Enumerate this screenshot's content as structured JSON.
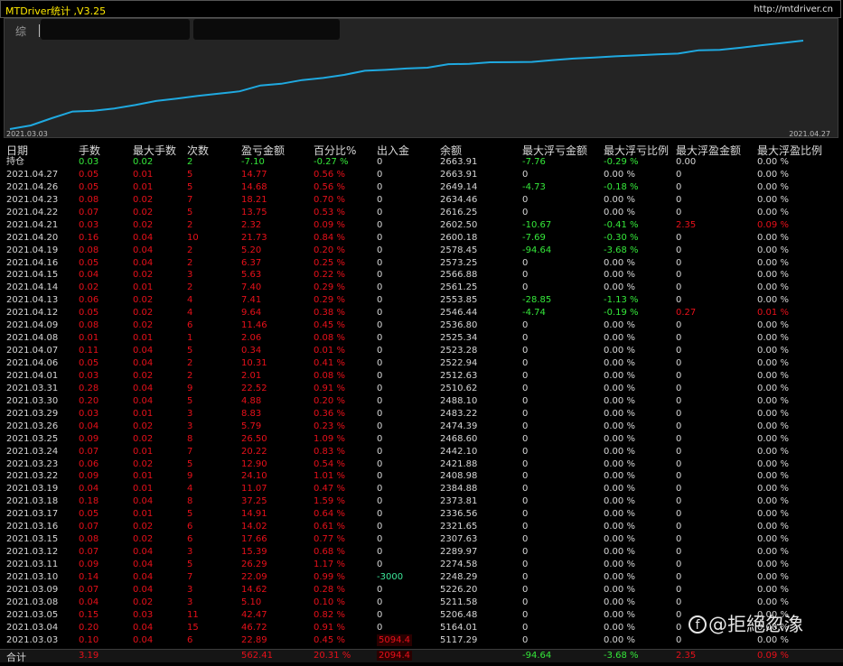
{
  "app": {
    "title": "MTDriver统计 ,V3.25",
    "url": "http://mtdriver.cn"
  },
  "chart_panel": {
    "tab_label": "综",
    "start_date": "2021.03.03",
    "end_date": "2021.04.27",
    "line_color": "#1fa9e0"
  },
  "chart_data": {
    "type": "line",
    "title": "",
    "xlabel": "",
    "ylabel": "",
    "x": [
      "2021.03.03",
      "2021.03.04",
      "2021.03.05",
      "2021.03.08",
      "2021.03.09",
      "2021.03.10",
      "2021.03.11",
      "2021.03.12",
      "2021.03.15",
      "2021.03.16",
      "2021.03.17",
      "2021.03.18",
      "2021.03.19",
      "2021.03.22",
      "2021.03.23",
      "2021.03.24",
      "2021.03.25",
      "2021.03.26",
      "2021.03.29",
      "2021.03.30",
      "2021.03.31",
      "2021.04.01",
      "2021.04.06",
      "2021.04.07",
      "2021.04.08",
      "2021.04.09",
      "2021.04.12",
      "2021.04.13",
      "2021.04.14",
      "2021.04.15",
      "2021.04.16",
      "2021.04.19",
      "2021.04.20",
      "2021.04.21",
      "2021.04.22",
      "2021.04.23",
      "2021.04.26",
      "2021.04.27"
    ],
    "series": [
      {
        "values": [
          22.89,
          69.62,
          112.09,
          117.19,
          131.81,
          153.9,
          180.19,
          195.58,
          213.24,
          227.26,
          242.17,
          279.42,
          290.49,
          314.59,
          327.49,
          347.71,
          374.21,
          380.0,
          388.83,
          393.71,
          416.23,
          418.24,
          428.55,
          428.89,
          430.95,
          442.41,
          452.05,
          459.46,
          466.86,
          472.49,
          478.86,
          484.06,
          505.79,
          508.11,
          521.86,
          538.07,
          552.75,
          567.52
        ]
      }
    ],
    "grid": false,
    "legend": "none"
  },
  "table": {
    "headers": [
      "日期",
      "手数",
      "最大手数",
      "次数",
      "盈亏金额",
      "百分比%",
      "出入金",
      "余额",
      "最大浮亏金额",
      "最大浮亏比例",
      "最大浮盈金额",
      "最大浮盈比例"
    ],
    "rows": [
      {
        "k": "pos",
        "cells": [
          "持仓",
          "0.03",
          "0.02",
          "2",
          "-7.10",
          "-0.27 %",
          "0",
          "2663.91",
          "-7.76",
          "-0.29 %",
          "0.00",
          "0.00 %"
        ]
      },
      {
        "k": "d",
        "cells": [
          "2021.04.27",
          "0.05",
          "0.01",
          "5",
          "14.77",
          "0.56 %",
          "0",
          "2663.91",
          "0",
          "0.00 %",
          "0",
          "0.00 %"
        ]
      },
      {
        "k": "d",
        "cells": [
          "2021.04.26",
          "0.05",
          "0.01",
          "5",
          "14.68",
          "0.56 %",
          "0",
          "2649.14",
          "-4.73",
          "-0.18 %",
          "0",
          "0.00 %"
        ]
      },
      {
        "k": "d",
        "cells": [
          "2021.04.23",
          "0.08",
          "0.02",
          "7",
          "18.21",
          "0.70 %",
          "0",
          "2634.46",
          "0",
          "0.00 %",
          "0",
          "0.00 %"
        ]
      },
      {
        "k": "d",
        "cells": [
          "2021.04.22",
          "0.07",
          "0.02",
          "5",
          "13.75",
          "0.53 %",
          "0",
          "2616.25",
          "0",
          "0.00 %",
          "0",
          "0.00 %"
        ]
      },
      {
        "k": "d",
        "cells": [
          "2021.04.21",
          "0.03",
          "0.02",
          "2",
          "2.32",
          "0.09 %",
          "0",
          "2602.50",
          "-10.67",
          "-0.41 %",
          "2.35",
          "0.09 %"
        ]
      },
      {
        "k": "d",
        "cells": [
          "2021.04.20",
          "0.16",
          "0.04",
          "10",
          "21.73",
          "0.84 %",
          "0",
          "2600.18",
          "-7.69",
          "-0.30 %",
          "0",
          "0.00 %"
        ]
      },
      {
        "k": "d",
        "cells": [
          "2021.04.19",
          "0.08",
          "0.04",
          "2",
          "5.20",
          "0.20 %",
          "0",
          "2578.45",
          "-94.64",
          "-3.68 %",
          "0",
          "0.00 %"
        ]
      },
      {
        "k": "d",
        "cells": [
          "2021.04.16",
          "0.05",
          "0.04",
          "2",
          "6.37",
          "0.25 %",
          "0",
          "2573.25",
          "0",
          "0.00 %",
          "0",
          "0.00 %"
        ]
      },
      {
        "k": "d",
        "cells": [
          "2021.04.15",
          "0.04",
          "0.02",
          "3",
          "5.63",
          "0.22 %",
          "0",
          "2566.88",
          "0",
          "0.00 %",
          "0",
          "0.00 %"
        ]
      },
      {
        "k": "d",
        "cells": [
          "2021.04.14",
          "0.02",
          "0.01",
          "2",
          "7.40",
          "0.29 %",
          "0",
          "2561.25",
          "0",
          "0.00 %",
          "0",
          "0.00 %"
        ]
      },
      {
        "k": "d",
        "cells": [
          "2021.04.13",
          "0.06",
          "0.02",
          "4",
          "7.41",
          "0.29 %",
          "0",
          "2553.85",
          "-28.85",
          "-1.13 %",
          "0",
          "0.00 %"
        ]
      },
      {
        "k": "d",
        "cells": [
          "2021.04.12",
          "0.05",
          "0.02",
          "4",
          "9.64",
          "0.38 %",
          "0",
          "2546.44",
          "-4.74",
          "-0.19 %",
          "0.27",
          "0.01 %"
        ]
      },
      {
        "k": "d",
        "cells": [
          "2021.04.09",
          "0.08",
          "0.02",
          "6",
          "11.46",
          "0.45 %",
          "0",
          "2536.80",
          "0",
          "0.00 %",
          "0",
          "0.00 %"
        ]
      },
      {
        "k": "d",
        "cells": [
          "2021.04.08",
          "0.01",
          "0.01",
          "1",
          "2.06",
          "0.08 %",
          "0",
          "2525.34",
          "0",
          "0.00 %",
          "0",
          "0.00 %"
        ]
      },
      {
        "k": "d",
        "cells": [
          "2021.04.07",
          "0.11",
          "0.04",
          "5",
          "0.34",
          "0.01 %",
          "0",
          "2523.28",
          "0",
          "0.00 %",
          "0",
          "0.00 %"
        ]
      },
      {
        "k": "d",
        "cells": [
          "2021.04.06",
          "0.05",
          "0.04",
          "2",
          "10.31",
          "0.41 %",
          "0",
          "2522.94",
          "0",
          "0.00 %",
          "0",
          "0.00 %"
        ]
      },
      {
        "k": "d",
        "cells": [
          "2021.04.01",
          "0.03",
          "0.02",
          "2",
          "2.01",
          "0.08 %",
          "0",
          "2512.63",
          "0",
          "0.00 %",
          "0",
          "0.00 %"
        ]
      },
      {
        "k": "d",
        "cells": [
          "2021.03.31",
          "0.28",
          "0.04",
          "9",
          "22.52",
          "0.91 %",
          "0",
          "2510.62",
          "0",
          "0.00 %",
          "0",
          "0.00 %"
        ]
      },
      {
        "k": "d",
        "cells": [
          "2021.03.30",
          "0.20",
          "0.04",
          "5",
          "4.88",
          "0.20 %",
          "0",
          "2488.10",
          "0",
          "0.00 %",
          "0",
          "0.00 %"
        ]
      },
      {
        "k": "d",
        "cells": [
          "2021.03.29",
          "0.03",
          "0.01",
          "3",
          "8.83",
          "0.36 %",
          "0",
          "2483.22",
          "0",
          "0.00 %",
          "0",
          "0.00 %"
        ]
      },
      {
        "k": "d",
        "cells": [
          "2021.03.26",
          "0.04",
          "0.02",
          "3",
          "5.79",
          "0.23 %",
          "0",
          "2474.39",
          "0",
          "0.00 %",
          "0",
          "0.00 %"
        ]
      },
      {
        "k": "d",
        "cells": [
          "2021.03.25",
          "0.09",
          "0.02",
          "8",
          "26.50",
          "1.09 %",
          "0",
          "2468.60",
          "0",
          "0.00 %",
          "0",
          "0.00 %"
        ]
      },
      {
        "k": "d",
        "cells": [
          "2021.03.24",
          "0.07",
          "0.01",
          "7",
          "20.22",
          "0.83 %",
          "0",
          "2442.10",
          "0",
          "0.00 %",
          "0",
          "0.00 %"
        ]
      },
      {
        "k": "d",
        "cells": [
          "2021.03.23",
          "0.06",
          "0.02",
          "5",
          "12.90",
          "0.54 %",
          "0",
          "2421.88",
          "0",
          "0.00 %",
          "0",
          "0.00 %"
        ]
      },
      {
        "k": "d",
        "cells": [
          "2021.03.22",
          "0.09",
          "0.01",
          "9",
          "24.10",
          "1.01 %",
          "0",
          "2408.98",
          "0",
          "0.00 %",
          "0",
          "0.00 %"
        ]
      },
      {
        "k": "d",
        "cells": [
          "2021.03.19",
          "0.04",
          "0.01",
          "4",
          "11.07",
          "0.47 %",
          "0",
          "2384.88",
          "0",
          "0.00 %",
          "0",
          "0.00 %"
        ]
      },
      {
        "k": "d",
        "cells": [
          "2021.03.18",
          "0.18",
          "0.04",
          "8",
          "37.25",
          "1.59 %",
          "0",
          "2373.81",
          "0",
          "0.00 %",
          "0",
          "0.00 %"
        ]
      },
      {
        "k": "d",
        "cells": [
          "2021.03.17",
          "0.05",
          "0.01",
          "5",
          "14.91",
          "0.64 %",
          "0",
          "2336.56",
          "0",
          "0.00 %",
          "0",
          "0.00 %"
        ]
      },
      {
        "k": "d",
        "cells": [
          "2021.03.16",
          "0.07",
          "0.02",
          "6",
          "14.02",
          "0.61 %",
          "0",
          "2321.65",
          "0",
          "0.00 %",
          "0",
          "0.00 %"
        ]
      },
      {
        "k": "d",
        "cells": [
          "2021.03.15",
          "0.08",
          "0.02",
          "6",
          "17.66",
          "0.77 %",
          "0",
          "2307.63",
          "0",
          "0.00 %",
          "0",
          "0.00 %"
        ]
      },
      {
        "k": "d",
        "cells": [
          "2021.03.12",
          "0.07",
          "0.04",
          "3",
          "15.39",
          "0.68 %",
          "0",
          "2289.97",
          "0",
          "0.00 %",
          "0",
          "0.00 %"
        ]
      },
      {
        "k": "d",
        "cells": [
          "2021.03.11",
          "0.09",
          "0.04",
          "5",
          "26.29",
          "1.17 %",
          "0",
          "2274.58",
          "0",
          "0.00 %",
          "0",
          "0.00 %"
        ]
      },
      {
        "k": "d",
        "cells": [
          "2021.03.10",
          "0.14",
          "0.04",
          "7",
          "22.09",
          "0.99 %",
          "-3000",
          "2248.29",
          "0",
          "0.00 %",
          "0",
          "0.00 %"
        ]
      },
      {
        "k": "d",
        "cells": [
          "2021.03.09",
          "0.07",
          "0.04",
          "3",
          "14.62",
          "0.28 %",
          "0",
          "5226.20",
          "0",
          "0.00 %",
          "0",
          "0.00 %"
        ]
      },
      {
        "k": "d",
        "cells": [
          "2021.03.08",
          "0.04",
          "0.02",
          "3",
          "5.10",
          "0.10 %",
          "0",
          "5211.58",
          "0",
          "0.00 %",
          "0",
          "0.00 %"
        ]
      },
      {
        "k": "d",
        "cells": [
          "2021.03.05",
          "0.15",
          "0.03",
          "11",
          "42.47",
          "0.82 %",
          "0",
          "5206.48",
          "0",
          "0.00 %",
          "0",
          "0.00 %"
        ]
      },
      {
        "k": "d",
        "cells": [
          "2021.03.04",
          "0.20",
          "0.04",
          "15",
          "46.72",
          "0.91 %",
          "0",
          "5164.01",
          "0",
          "0.00 %",
          "0",
          "0.00 %"
        ]
      },
      {
        "k": "d",
        "cells": [
          "2021.03.03",
          "0.10",
          "0.04",
          "6",
          "22.89",
          "0.45 %",
          "5094.4",
          "5117.29",
          "0",
          "0.00 %",
          "0",
          "0.00 %"
        ]
      }
    ],
    "total": {
      "label": "合计",
      "lots": "3.19",
      "pnl": "562.41",
      "pct": "20.31 %",
      "deposit": "2094.4",
      "max_float_loss": "-94.64",
      "max_float_loss_pct": "-3.68 %",
      "max_float_profit": "2.35",
      "max_float_profit_pct": "0.09 %"
    }
  },
  "watermark": {
    "logo_glyph": "f",
    "text": "@拒絕忽潒"
  },
  "colors": {
    "profit": "#e8101a",
    "loss": "#35e83a",
    "neutral": "#d6d6d6",
    "title": "#ffea00"
  }
}
